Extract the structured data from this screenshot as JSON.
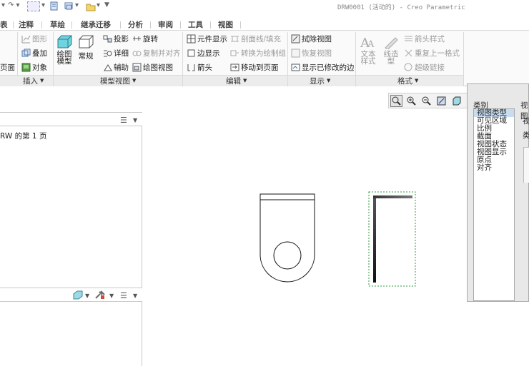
{
  "window": {
    "title": "DRW0001 (活动的) - Creo Parametric"
  },
  "quick_access": {
    "items": [
      "undo-icon",
      "redo-icon",
      "select-box-icon",
      "regenerate-icon",
      "windows-icon",
      "folder-icon",
      "customize-icon"
    ]
  },
  "tabs": [
    {
      "label": "表"
    },
    {
      "label": "注释"
    },
    {
      "label": "草绘"
    },
    {
      "label": "继承迁移"
    },
    {
      "label": "分析"
    },
    {
      "label": "审阅"
    },
    {
      "label": "工具"
    },
    {
      "label": "视图"
    }
  ],
  "ribbon": {
    "insert": {
      "col1": [
        "页面"
      ],
      "col2": [
        "图形",
        "叠加",
        "对象"
      ],
      "label": "插入"
    },
    "model_views": {
      "big": [
        "绘图模型",
        "常规"
      ],
      "col1": [
        "投影",
        "详细",
        "辅助"
      ],
      "col2": [
        "旋转",
        "复制并对齐",
        "绘图视图"
      ],
      "label": "模型视图"
    },
    "edit": {
      "col1": [
        "元件显示",
        "边显示",
        "箭头"
      ],
      "col2": [
        "剖面线/填充",
        "转换为绘制组",
        "移动到页面"
      ],
      "label": "编辑"
    },
    "display": {
      "items": [
        "拭除视图",
        "恢复视图",
        "显示已修改的边"
      ],
      "label": "显示"
    },
    "format": {
      "big": [
        "文本样式",
        "线造型"
      ],
      "items": [
        "箭头样式",
        "重复上一格式",
        "超级链接"
      ],
      "label": "格式"
    }
  },
  "left_panel": {
    "tree_item": "RW 的第 1 页"
  },
  "dialog": {
    "category_label": "类别",
    "categories": [
      "视图类型",
      "可见区域",
      "比例",
      "截面",
      "视图状态",
      "视图显示",
      "原点",
      "对齐"
    ],
    "selected": "视图类型",
    "right_header": "视图",
    "right_text_1": "视",
    "right_text_2": "类"
  },
  "colors": {
    "selection_green": "#2e9e3e",
    "selection_row": "#c8dcf0"
  }
}
